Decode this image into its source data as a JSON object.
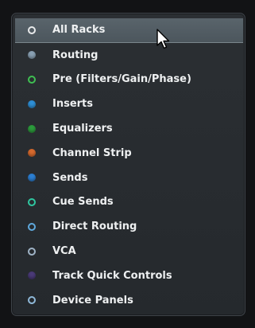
{
  "menu": {
    "items": [
      {
        "label": "All Racks",
        "dot_style": "ring",
        "dot_color": "#e8eaeb",
        "selected": true
      },
      {
        "label": "Routing",
        "dot_style": "fill",
        "dot_color": "#8aa1b4",
        "selected": false
      },
      {
        "label": "Pre (Filters/Gain/Phase)",
        "dot_style": "ring",
        "dot_color": "#3fbf52",
        "selected": false
      },
      {
        "label": "Inserts",
        "dot_style": "fill",
        "dot_color": "#2e8fd6",
        "selected": false
      },
      {
        "label": "Equalizers",
        "dot_style": "fill",
        "dot_color": "#2c9b3c",
        "selected": false
      },
      {
        "label": "Channel Strip",
        "dot_style": "fill",
        "dot_color": "#d66a2e",
        "selected": false
      },
      {
        "label": "Sends",
        "dot_style": "fill",
        "dot_color": "#2c7fd2",
        "selected": false
      },
      {
        "label": "Cue Sends",
        "dot_style": "ring",
        "dot_color": "#2fc7a0",
        "selected": false
      },
      {
        "label": "Direct Routing",
        "dot_style": "ring",
        "dot_color": "#5fa9dd",
        "selected": false
      },
      {
        "label": "VCA",
        "dot_style": "ring",
        "dot_color": "#9fb3c6",
        "selected": false
      },
      {
        "label": "Track Quick Controls",
        "dot_style": "fill",
        "dot_color": "#4a3a78",
        "selected": false
      },
      {
        "label": "Device Panels",
        "dot_style": "ring",
        "dot_color": "#8fb8d8",
        "selected": false
      }
    ]
  },
  "cursor": {
    "icon": "mouse-pointer-icon"
  }
}
